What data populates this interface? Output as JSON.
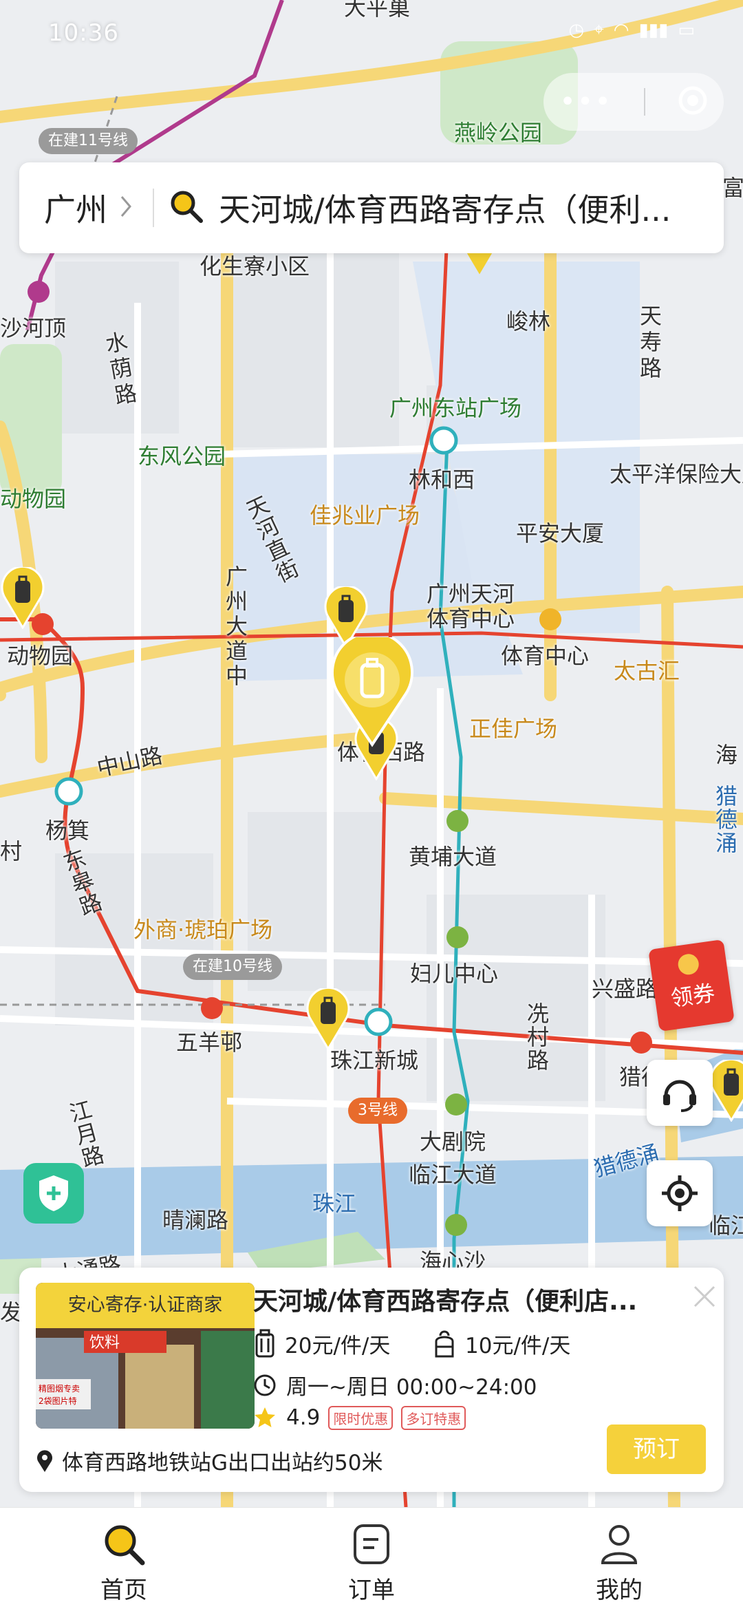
{
  "status": {
    "time": "10:36"
  },
  "search": {
    "city": "广州",
    "query": "天河城/体育西路寄存点（便利..."
  },
  "map_labels": [
    {
      "text": "大平巢"
    },
    {
      "text": "燕岭公园"
    },
    {
      "text": "化生寮小区"
    },
    {
      "text": "沙河顶"
    },
    {
      "text": "峻林"
    },
    {
      "text": "天寿路"
    },
    {
      "text": "水荫路"
    },
    {
      "text": "广州东站广场"
    },
    {
      "text": "东风公园"
    },
    {
      "text": "林和西"
    },
    {
      "text": "太平洋保险大厦"
    },
    {
      "text": "动物园"
    },
    {
      "text": "佳兆业广场"
    },
    {
      "text": "天河直街"
    },
    {
      "text": "平安大厦"
    },
    {
      "text": "广州天河"
    },
    {
      "text": "体育中心"
    },
    {
      "text": "体育中心"
    },
    {
      "text": "太古汇"
    },
    {
      "text": "动物园"
    },
    {
      "text": "广州大道中"
    },
    {
      "text": "正佳广场"
    },
    {
      "text": "体育西路"
    },
    {
      "text": "中山路"
    },
    {
      "text": "杨箕"
    },
    {
      "text": "黄埔大道"
    },
    {
      "text": "东皋路"
    },
    {
      "text": "外商·琥珀广场"
    },
    {
      "text": "妇儿中心"
    },
    {
      "text": "兴盛路"
    },
    {
      "text": "五羊邨"
    },
    {
      "text": "珠江新城"
    },
    {
      "text": "冼村路"
    },
    {
      "text": "猎德"
    },
    {
      "text": "江月路"
    },
    {
      "text": "大剧院"
    },
    {
      "text": "临江大道"
    },
    {
      "text": "猎德涌"
    },
    {
      "text": "晴澜路"
    },
    {
      "text": "珠江"
    },
    {
      "text": "海心沙"
    },
    {
      "text": "猎德涌"
    },
    {
      "text": "海"
    },
    {
      "text": "临江"
    },
    {
      "text": "富"
    },
    {
      "text": "村"
    },
    {
      "text": "大通路"
    },
    {
      "text": "发"
    }
  ],
  "line_tags": {
    "line11": "在建11号线",
    "line10": "在建10号线",
    "line3": "3号线"
  },
  "coupon": {
    "label": "领券"
  },
  "card": {
    "tag": "安心寄存·认证商家",
    "title": "天河城/体育西路寄存点（便利店...",
    "price_large": "20元/件/天",
    "price_small": "10元/件/天",
    "hours": "周一~周日 00:00~24:00",
    "rating": "4.9",
    "badges": [
      "限时优惠",
      "多订特惠"
    ],
    "address": "体育西路地铁站G出口出站约50米",
    "book_label": "预订",
    "thumb_text_1": "饮料",
    "thumb_text_2": "精图烟专卖",
    "thumb_text_3": "2袋图片特"
  },
  "tabs": [
    {
      "label": "首页"
    },
    {
      "label": "订单"
    },
    {
      "label": "我的"
    }
  ],
  "colors": {
    "accent": "#f5d13b",
    "pin": "#f2cf2f",
    "metro_red": "#e5432f",
    "metro_teal": "#2fb0bc",
    "water": "#a9cbe8"
  }
}
